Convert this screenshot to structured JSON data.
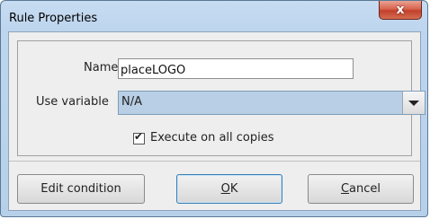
{
  "window": {
    "title": "Rule Properties",
    "close_glyph": "x"
  },
  "form": {
    "name_label": "Name",
    "name_value": "placeLOGO",
    "variable_label": "Use variable",
    "variable_value": "N/A",
    "execute_label": "Execute on all copies",
    "execute_checked": true,
    "checkmark": "✔"
  },
  "buttons": {
    "edit_condition": "Edit condition",
    "ok_mnemonic": "O",
    "ok_rest": "K",
    "cancel_mnemonic": "C",
    "cancel_rest": "ancel"
  },
  "icons": {
    "close": "close-icon",
    "dropdown": "chevron-down-icon",
    "check": "check-icon"
  }
}
